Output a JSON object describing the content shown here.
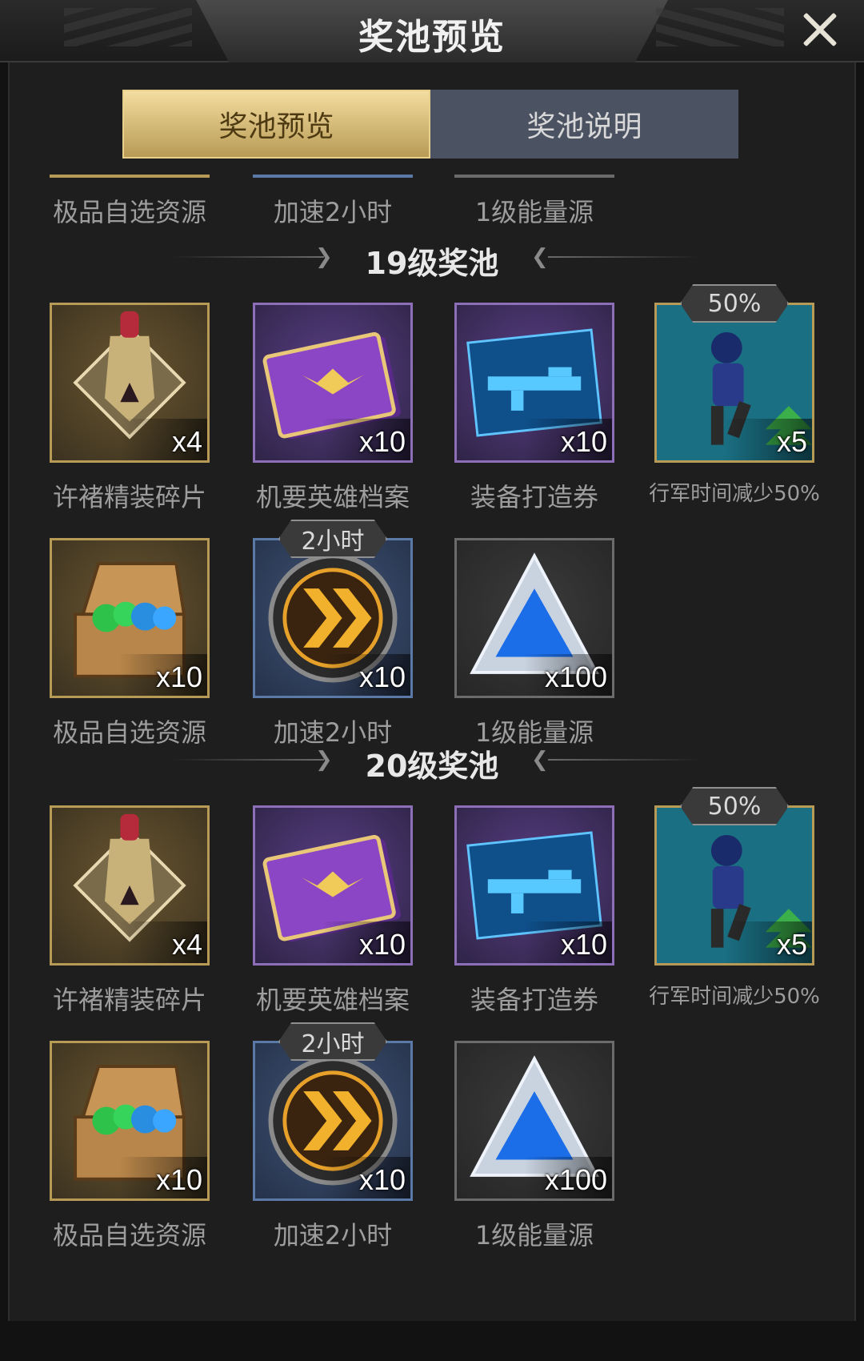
{
  "header": {
    "title": "奖池预览"
  },
  "tabs": [
    {
      "label": "奖池预览",
      "active": true
    },
    {
      "label": "奖池说明",
      "active": false
    }
  ],
  "partial_row": {
    "labels": [
      "极品自选资源",
      "加速2小时",
      "1级能量源"
    ]
  },
  "pools": [
    {
      "title": "19级奖池",
      "items": [
        {
          "icon": "armor-fragment-icon",
          "qty": "x4",
          "label": "许褚精装碎片",
          "rarity": "gold"
        },
        {
          "icon": "hero-file-icon",
          "qty": "x10",
          "label": "机要英雄档案",
          "rarity": "purple"
        },
        {
          "icon": "weapon-blueprint-icon",
          "qty": "x10",
          "label": "装备打造券",
          "rarity": "purple"
        },
        {
          "icon": "soldier-march-icon",
          "qty": "x5",
          "label": "行军时间减少50%",
          "badge": "50%",
          "rarity": "gold"
        },
        {
          "icon": "resource-chest-icon",
          "qty": "x10",
          "label": "极品自选资源",
          "rarity": "gold"
        },
        {
          "icon": "speedup-icon",
          "qty": "x10",
          "label": "加速2小时",
          "badge": "2小时",
          "rarity": "blue"
        },
        {
          "icon": "energy-crystal-icon",
          "qty": "x100",
          "label": "1级能量源",
          "rarity": "gray"
        }
      ]
    },
    {
      "title": "20级奖池",
      "items": [
        {
          "icon": "armor-fragment-icon",
          "qty": "x4",
          "label": "许褚精装碎片",
          "rarity": "gold"
        },
        {
          "icon": "hero-file-icon",
          "qty": "x10",
          "label": "机要英雄档案",
          "rarity": "purple"
        },
        {
          "icon": "weapon-blueprint-icon",
          "qty": "x10",
          "label": "装备打造券",
          "rarity": "purple"
        },
        {
          "icon": "soldier-march-icon",
          "qty": "x5",
          "label": "行军时间减少50%",
          "badge": "50%",
          "rarity": "gold"
        },
        {
          "icon": "resource-chest-icon",
          "qty": "x10",
          "label": "极品自选资源",
          "rarity": "gold"
        },
        {
          "icon": "speedup-icon",
          "qty": "x10",
          "label": "加速2小时",
          "badge": "2小时",
          "rarity": "blue"
        },
        {
          "icon": "energy-crystal-icon",
          "qty": "x100",
          "label": "1级能量源",
          "rarity": "gray"
        }
      ]
    }
  ]
}
